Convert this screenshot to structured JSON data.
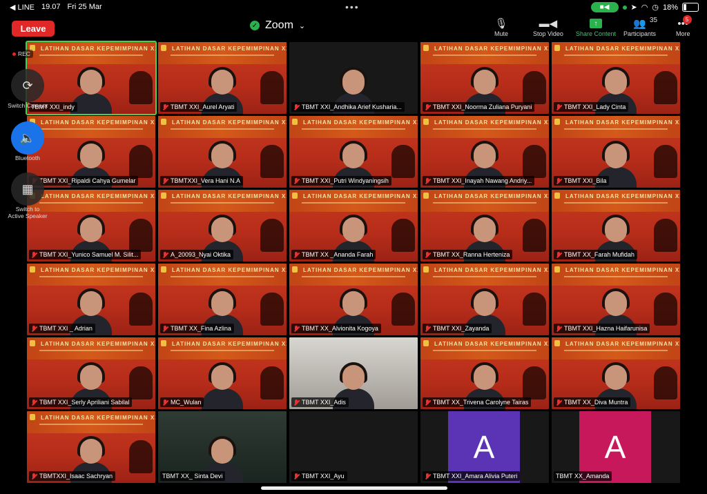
{
  "status": {
    "back_app": "◀ LINE",
    "time": "19.07",
    "date": "Fri 25 Mar",
    "battery": "18%"
  },
  "toolbar": {
    "leave": "Leave",
    "title": "Zoom",
    "mute": "Mute",
    "stop_video": "Stop Video",
    "share": "Share Content",
    "participants": "Participants",
    "participants_count": "35",
    "more": "More",
    "more_badge": "5"
  },
  "floating": {
    "rec": "REC",
    "switch_camera": "Switch Camera",
    "bluetooth": "Bluetooth",
    "switch_to": "Switch to",
    "active_speaker": "Active Speaker"
  },
  "banner": {
    "title": "LATIHAN DASAR KEPEMIMPINAN XXI"
  },
  "tiles": [
    {
      "name": "TBMT XXI_indy",
      "muted": false,
      "kind": "red",
      "active": true
    },
    {
      "name": "TBMT XXI_Aurel Aryati",
      "muted": true,
      "kind": "red"
    },
    {
      "name": "TBMT XXI_Andhika Arief Kusharia...",
      "muted": true,
      "kind": "dark"
    },
    {
      "name": "TBMT XXI_Noorma Zuliana Puryani",
      "muted": true,
      "kind": "red"
    },
    {
      "name": "TBMT XXI_Lady Cinta",
      "muted": true,
      "kind": "red"
    },
    {
      "name": "TBMT XXI_Ripaldi Cahya Gumelar",
      "muted": true,
      "kind": "red"
    },
    {
      "name": "TBMTXXI_Vera Hani N.A",
      "muted": true,
      "kind": "red"
    },
    {
      "name": "TBMT XXI_Putri Windyaningsih",
      "muted": true,
      "kind": "red"
    },
    {
      "name": "TBMT XXI_Inayah Nawang Andriy...",
      "muted": true,
      "kind": "red"
    },
    {
      "name": "TBMT XXI_Bila",
      "muted": true,
      "kind": "red"
    },
    {
      "name": "TBMT XXI_Yunico Samuel M. Silit...",
      "muted": true,
      "kind": "red"
    },
    {
      "name": "A_20093_Nyai Oktika",
      "muted": true,
      "kind": "red"
    },
    {
      "name": "TBMT XX _Ananda Farah",
      "muted": true,
      "kind": "red"
    },
    {
      "name": "TBMT XX_Ranna Herteniza",
      "muted": true,
      "kind": "red"
    },
    {
      "name": "TBMT XX_Farah Mufidah",
      "muted": true,
      "kind": "red"
    },
    {
      "name": "TBMT XXI _ Adrian",
      "muted": true,
      "kind": "red"
    },
    {
      "name": "TBMT XX_Fina Azlina",
      "muted": true,
      "kind": "red"
    },
    {
      "name": "TBMT XX_Alvionita Kogoya",
      "muted": true,
      "kind": "red"
    },
    {
      "name": "TBMT XXI_Zayanda",
      "muted": true,
      "kind": "red"
    },
    {
      "name": "TBMT XXI_Hazna Haifarunisa",
      "muted": true,
      "kind": "red"
    },
    {
      "name": "TBMT XXI_Serly Apriliani Sabilal",
      "muted": true,
      "kind": "red"
    },
    {
      "name": "MC_Wulan",
      "muted": true,
      "kind": "red"
    },
    {
      "name": "TBMT XXI_Adis",
      "muted": true,
      "kind": "room"
    },
    {
      "name": "TBMT XX_Trivena Carolyne Tairas",
      "muted": true,
      "kind": "red"
    },
    {
      "name": "TBMT XX_Diva Muntra",
      "muted": true,
      "kind": "red"
    },
    {
      "name": "TBMTXXI_Isaac Sachryan",
      "muted": true,
      "kind": "red"
    },
    {
      "name": "TBMT XX_ Sinta Devi",
      "muted": false,
      "kind": "room2"
    },
    {
      "name": "TBMT XXI_Ayu",
      "muted": true,
      "kind": "dark"
    },
    {
      "name": "TBMT XXI_Amara Alivia Puteri",
      "muted": true,
      "kind": "avatar",
      "avatar_letter": "A",
      "avatar_color": "#5b33b5"
    },
    {
      "name": "TBMT XX_Amanda",
      "muted": false,
      "kind": "avatar",
      "avatar_letter": "A",
      "avatar_color": "#c6185a"
    }
  ]
}
